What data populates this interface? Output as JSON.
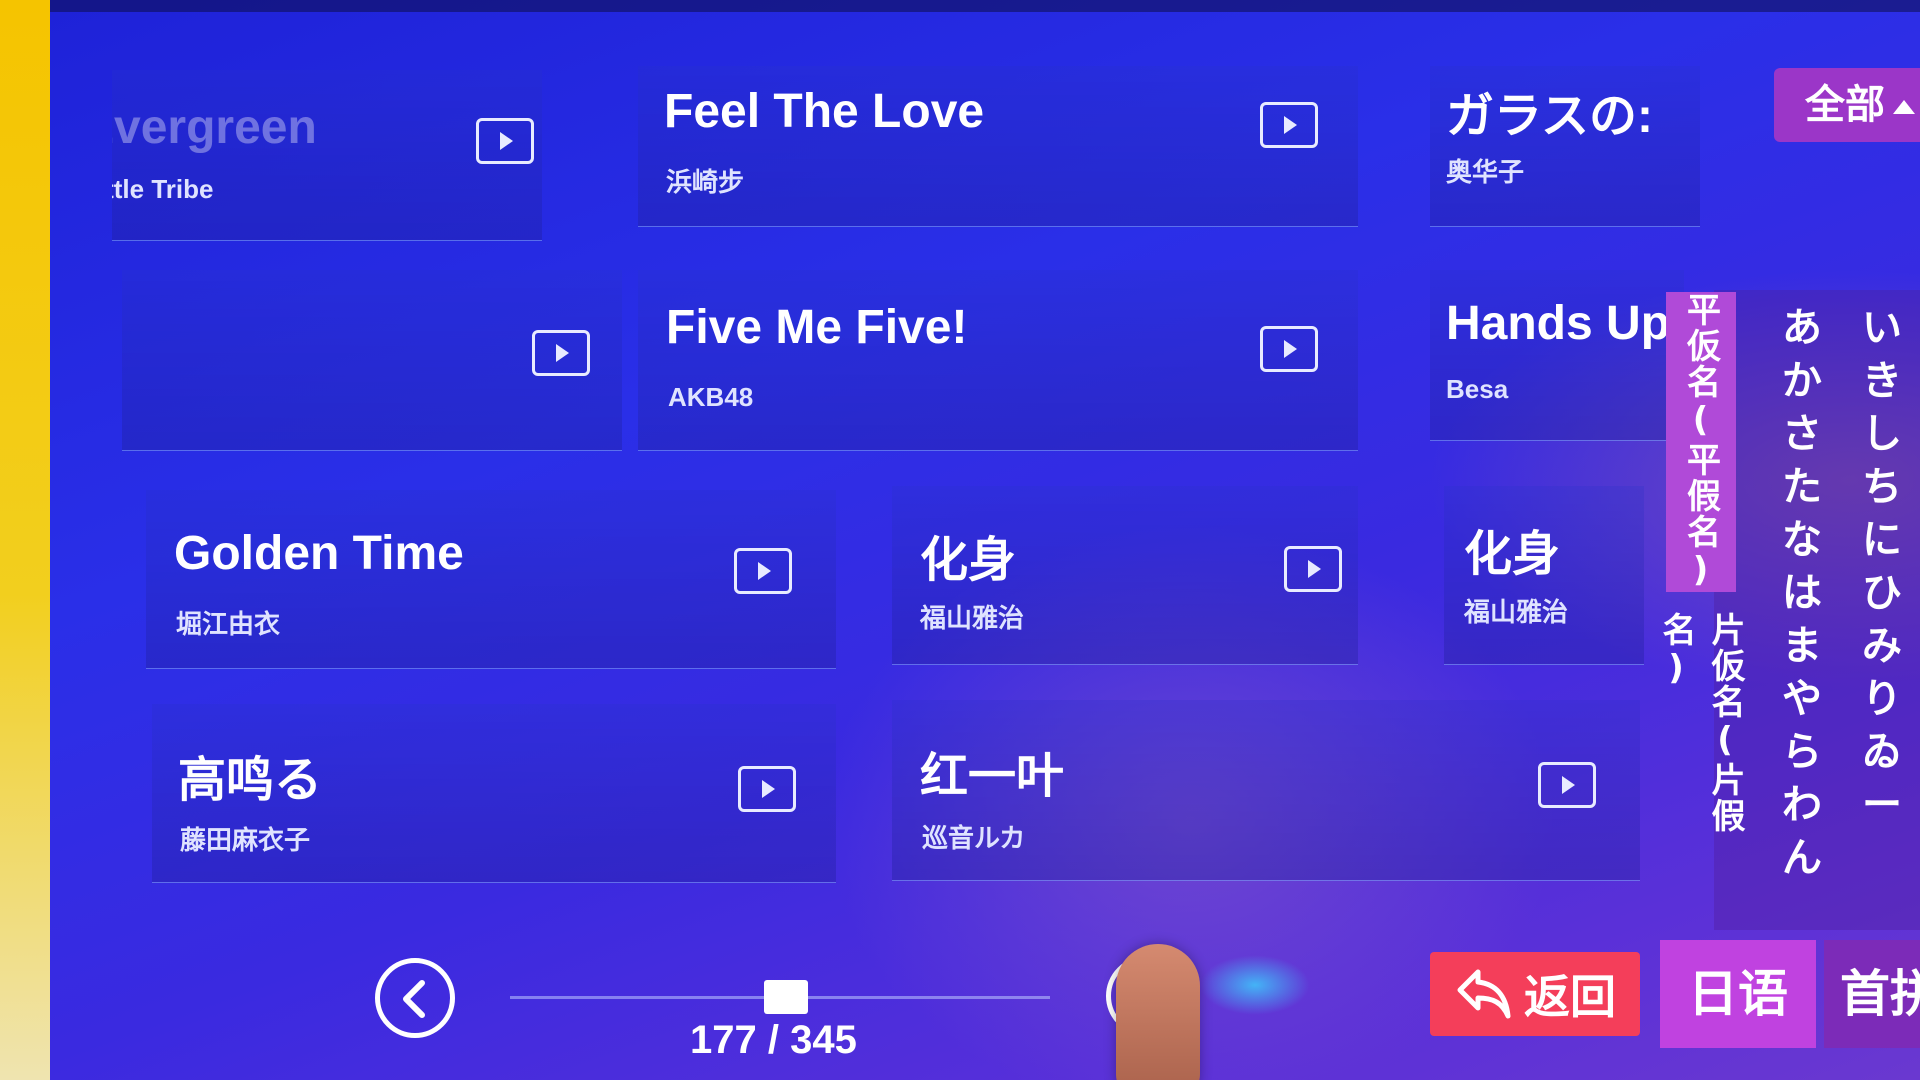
{
  "songs": [
    {
      "id": "song1",
      "title": "Evergreen",
      "artist": "Little Tribe"
    },
    {
      "id": "song2",
      "title": "Feel The Love",
      "artist": "浜崎步"
    },
    {
      "id": "song3",
      "title": "ガラスの:",
      "artist": "奥华子"
    },
    {
      "id": "song4",
      "title": "",
      "artist": ""
    },
    {
      "id": "song5",
      "title": "Five Me Five!",
      "artist": "AKB48"
    },
    {
      "id": "song6",
      "title": "Hands Up",
      "artist": "Besa"
    },
    {
      "id": "song7",
      "title": "Golden Time",
      "artist": "堀江由衣"
    },
    {
      "id": "song8",
      "title": "化身",
      "artist": "福山雅治"
    },
    {
      "id": "song9",
      "title": "化身",
      "artist": "福山雅治"
    },
    {
      "id": "song10",
      "title": "高鸣る",
      "artist": "藤田麻衣子"
    },
    {
      "id": "song11",
      "title": "红一叶",
      "artist": "巡音ルカ"
    }
  ],
  "filter": {
    "label": "全部"
  },
  "side_tabs": {
    "hiragana": "平仮名(平假名)",
    "katakana": "片仮名(片假名)"
  },
  "kana_columns": {
    "col1": [
      "あ",
      "か",
      "さ",
      "た",
      "な",
      "は",
      "ま",
      "や",
      "ら",
      "わ",
      "ん"
    ],
    "col2": [
      "い",
      "き",
      "し",
      "ち",
      "に",
      "ひ",
      "み",
      "",
      "り",
      "ゐ",
      "ー"
    ]
  },
  "bottom_tabs": {
    "japanese": "日语",
    "first": "首拼"
  },
  "back_button": {
    "label": "返回"
  },
  "pagination": {
    "current": 177,
    "total": 345,
    "text": "177 / 345"
  },
  "colors": {
    "accent_purple": "#9b36c8",
    "back_red": "#f43e5a",
    "background_blue": "#1e22d8"
  },
  "icons": {
    "play": "play-video-icon",
    "prev": "chevron-left-icon",
    "back": "return-arrow-icon"
  }
}
